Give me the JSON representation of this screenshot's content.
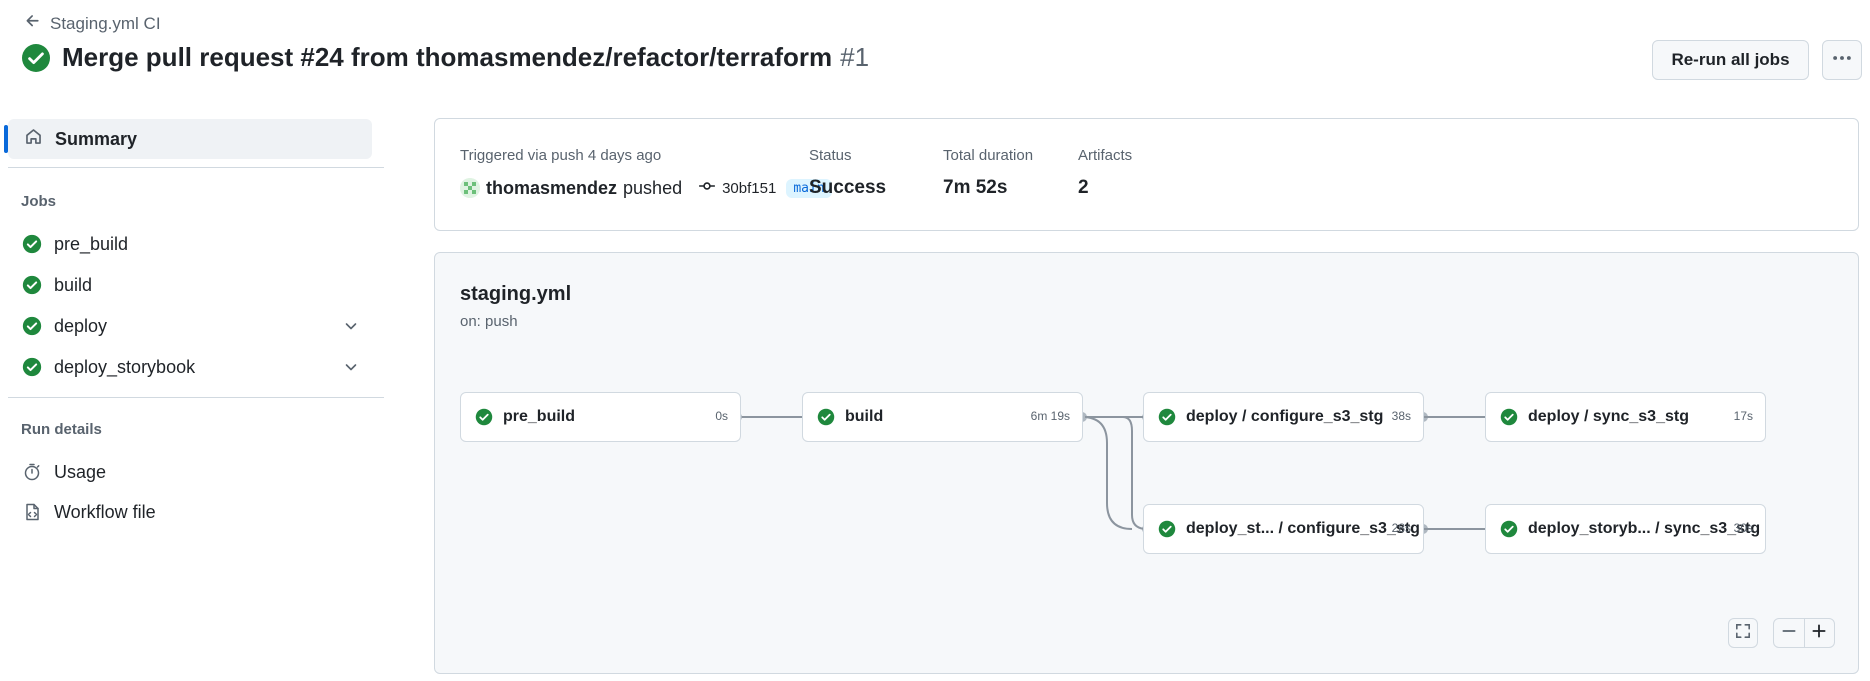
{
  "header": {
    "back_label": "Staging.yml CI",
    "title": "Merge pull request #24 from thomasmendez/refactor/terraform",
    "run_number": "#1",
    "rerun_label": "Re-run all jobs",
    "status_icon": "check-circle-fill-icon",
    "more_icon": "kebab-horizontal-icon"
  },
  "sidebar": {
    "summary_label": "Summary",
    "jobs_heading": "Jobs",
    "jobs": [
      {
        "label": "pre_build",
        "expandable": false
      },
      {
        "label": "build",
        "expandable": false
      },
      {
        "label": "deploy",
        "expandable": true
      },
      {
        "label": "deploy_storybook",
        "expandable": true
      }
    ],
    "run_details_heading": "Run details",
    "run_details": [
      {
        "label": "Usage",
        "icon": "stopwatch-icon"
      },
      {
        "label": "Workflow file",
        "icon": "file-code-icon"
      }
    ]
  },
  "summary": {
    "trigger_label": "Triggered via push 4 days ago",
    "actor": "thomasmendez",
    "verb": "pushed",
    "commit_sha": "30bf151",
    "branch": "main",
    "status_label": "Status",
    "status_value": "Success",
    "duration_label": "Total duration",
    "duration_value": "7m 52s",
    "artifacts_label": "Artifacts",
    "artifacts_value": "2"
  },
  "graph": {
    "workflow_name": "staging.yml",
    "workflow_trigger": "on: push",
    "jobs": [
      {
        "name": "pre_build",
        "duration": "0s"
      },
      {
        "name": "build",
        "duration": "6m 19s"
      },
      {
        "name": "deploy / configure_s3_stg",
        "duration": "38s"
      },
      {
        "name": "deploy / sync_s3_stg",
        "duration": "17s"
      },
      {
        "name": "deploy_st... / configure_s3_stg",
        "duration": "28s"
      },
      {
        "name": "deploy_storyb... / sync_s3_stg",
        "duration": "30s"
      }
    ]
  },
  "colors": {
    "success": "#1f883d",
    "accent": "#0969da",
    "border": "#d1d9e0",
    "muted": "#59636e"
  }
}
